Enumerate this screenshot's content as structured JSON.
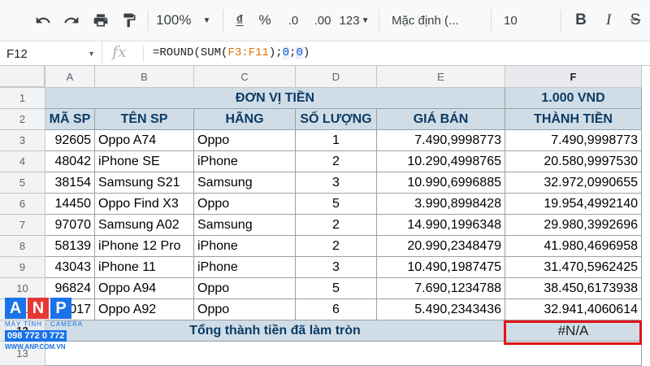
{
  "toolbar": {
    "zoom": "100%",
    "currency_symbol": "₫",
    "percent_symbol": "%",
    "decrease_decimal": ".0",
    "increase_decimal": ".00",
    "more_formats": "123",
    "font_name": "Mặc định (...",
    "font_size": "10",
    "bold": "B",
    "italic": "I",
    "strikethrough": "S"
  },
  "formula_bar": {
    "cell_ref": "F12",
    "fx": "fx",
    "formula_parts": [
      "=ROUND(SUM(",
      "F3:F11",
      ");",
      "0",
      ";",
      "0",
      ")"
    ]
  },
  "columns": [
    "A",
    "B",
    "C",
    "D",
    "E",
    "F"
  ],
  "rows": [
    "1",
    "2",
    "3",
    "4",
    "5",
    "6",
    "7",
    "8",
    "9",
    "10",
    "11",
    "12",
    "13"
  ],
  "sheet": {
    "merged_header": "ĐƠN VỊ TIỀN",
    "unit": "1.000 VND",
    "headers": [
      "MÃ SP",
      "TÊN SP",
      "HÃNG",
      "SỐ LƯỢNG",
      "GIÁ BÁN",
      "THÀNH TIỀN"
    ],
    "data": [
      [
        "92605",
        "Oppo A74",
        "Oppo",
        "1",
        "7.490,9998773",
        "7.490,9998773"
      ],
      [
        "48042",
        "iPhone SE",
        "iPhone",
        "2",
        "10.290,4998765",
        "20.580,9997530"
      ],
      [
        "38154",
        "Samsung S21",
        "Samsung",
        "3",
        "10.990,6996885",
        "32.972,0990655"
      ],
      [
        "14450",
        "Oppo Find X3",
        "Oppo",
        "5",
        "3.990,8998428",
        "19.954,4992140"
      ],
      [
        "97070",
        "Samsung A02",
        "Samsung",
        "2",
        "14.990,1996348",
        "29.980,3992696"
      ],
      [
        "58139",
        "iPhone 12 Pro",
        "iPhone",
        "2",
        "20.990,2348479",
        "41.980,4696958"
      ],
      [
        "43043",
        "iPhone 11",
        "iPhone",
        "3",
        "10.490,1987475",
        "31.470,5962425"
      ],
      [
        "96824",
        "Oppo A94",
        "Oppo",
        "5",
        "7.690,1234788",
        "38.450,6173938"
      ],
      [
        "40017",
        "Oppo A92",
        "Oppo",
        "6",
        "5.490,2343436",
        "32.941,4060614"
      ]
    ],
    "total_label": "Tổng thành tiền đã làm tròn",
    "total_value": "#N/A"
  },
  "watermark": {
    "letters": [
      "A",
      "N",
      "P"
    ],
    "tagline": "MÁY TÍNH · CAMERA",
    "phone": "098 772 0 772",
    "website": "WWW.ANP.COM.VN"
  },
  "colors": {
    "header_fill": "#d0dde6",
    "header_text": "#0b3b66",
    "selection_border": "#e0141b"
  }
}
